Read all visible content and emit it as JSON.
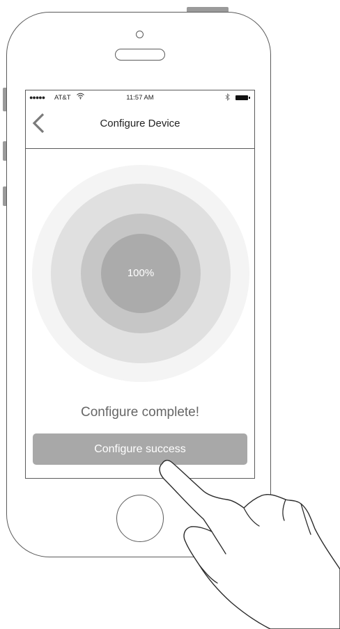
{
  "status_bar": {
    "signal": "●●●●●",
    "carrier": "AT&T",
    "wifi_icon": "wifi-icon",
    "time": "11:57 AM",
    "bluetooth_icon": "bluetooth-icon",
    "battery_icon": "battery-icon"
  },
  "nav": {
    "back_icon": "chevron-left-icon",
    "title": "Configure Device"
  },
  "progress": {
    "value": 100,
    "label": "100%"
  },
  "status": {
    "message": "Configure complete!"
  },
  "actions": {
    "success_label": "Configure success"
  },
  "colors": {
    "button_bg": "#a8a8a8",
    "ring_outer": "#f4f4f4",
    "ring_2": "#e0e0e0",
    "ring_3": "#c6c6c6",
    "ring_inner": "#ababab"
  }
}
